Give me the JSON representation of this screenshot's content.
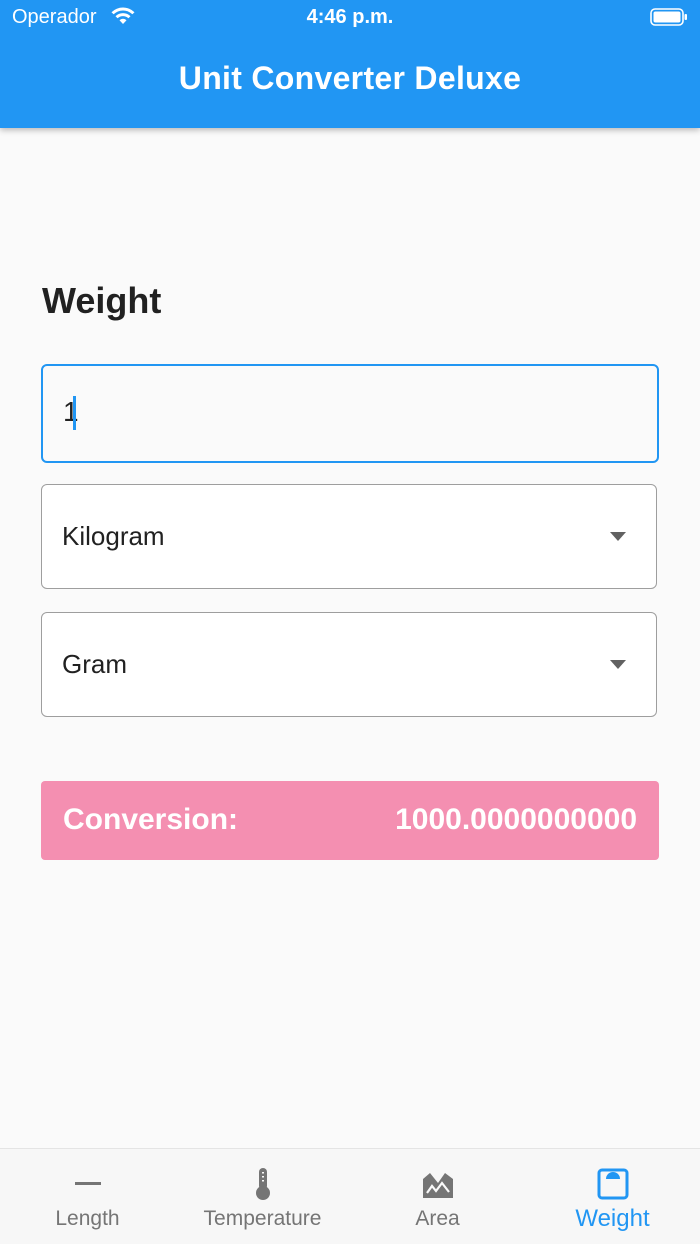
{
  "status_bar": {
    "carrier": "Operador",
    "time": "4:46 p.m."
  },
  "appbar": {
    "title": "Unit Converter Deluxe"
  },
  "converter": {
    "category_title": "Weight",
    "input_value": "1",
    "from_unit": "Kilogram",
    "to_unit": "Gram",
    "result_label": "Conversion:",
    "result_value": "1000.0000000000"
  },
  "bottom_nav": {
    "items": [
      {
        "label": "Length",
        "icon": "length-icon",
        "active": false
      },
      {
        "label": "Temperature",
        "icon": "thermometer-icon",
        "active": false
      },
      {
        "label": "Area",
        "icon": "area-icon",
        "active": false
      },
      {
        "label": "Weight",
        "icon": "scale-icon",
        "active": true
      }
    ]
  },
  "colors": {
    "primary": "#2196f3",
    "result_background": "#f48fb1",
    "inactive_nav": "#757575"
  }
}
